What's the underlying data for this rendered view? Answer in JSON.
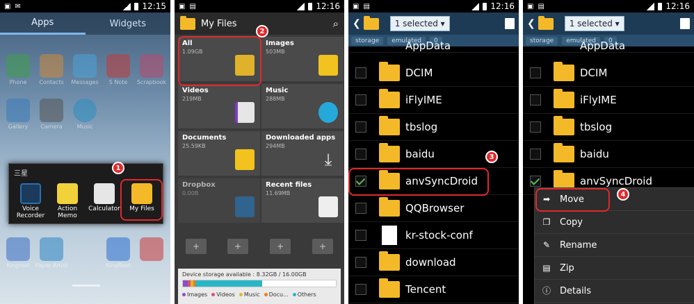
{
  "panel1": {
    "time": "12:15",
    "tabs": [
      "Apps",
      "Widgets"
    ],
    "bg_apps": [
      "Phone",
      "Contacts",
      "Messages",
      "S Note",
      "Scrapbook",
      "Gallery",
      "Camera",
      "Music",
      "Kingroot",
      "Paper Artist",
      "KingRoot"
    ],
    "folder_title": "三星",
    "folder_apps": [
      "Voice\nRecorder",
      "Action\nMemo",
      "Calculator",
      "My Files"
    ],
    "badge": "1"
  },
  "panel2": {
    "time": "12:16",
    "title": "My Files",
    "badge": "2",
    "categories": [
      {
        "name": "All",
        "size": "1.09GB"
      },
      {
        "name": "Images",
        "size": "503MB"
      },
      {
        "name": "Videos",
        "size": "219MB"
      },
      {
        "name": "Music",
        "size": "288MB"
      },
      {
        "name": "Documents",
        "size": "25.59KB"
      },
      {
        "name": "Downloaded apps",
        "size": "294MB"
      },
      {
        "name": "Dropbox",
        "size": "0.00B"
      },
      {
        "name": "Recent files",
        "size": "11.69MB"
      }
    ],
    "storage_label": "Device storage available : 8.32GB / 16.00GB",
    "legend": [
      "Images",
      "Videos",
      "Music",
      "Docu...",
      "Others"
    ],
    "legend_colors": [
      "#8a4fc2",
      "#e04a7f",
      "#e2b81f",
      "#f07d1a",
      "#29b7c6"
    ],
    "bar_fractions": [
      0.03,
      0.02,
      0.02,
      0.01,
      0.44
    ]
  },
  "panel3": {
    "time": "12:16",
    "selected": "1 selected",
    "crumbs": [
      "storage",
      "emulated",
      "0"
    ],
    "partial_top": "AppData",
    "folders": [
      "DCIM",
      "iFlyIME",
      "tbslog",
      "baidu",
      "anvSyncDroid",
      "QQBrowser",
      "kr-stock-conf",
      "download",
      "Tencent"
    ],
    "badge": "3"
  },
  "panel4": {
    "time": "12:16",
    "selected": "1 selected",
    "crumbs": [
      "storage",
      "emulated",
      "0"
    ],
    "partial_top": "AppData",
    "folders": [
      "DCIM",
      "iFlyIME",
      "tbslog",
      "baidu",
      "anvSyncDroid"
    ],
    "menu": [
      "Move",
      "Copy",
      "Rename",
      "Zip",
      "Details"
    ],
    "menu_icons": [
      "arrow-right-icon",
      "copy-icon",
      "rename-icon",
      "zip-icon",
      "info-icon"
    ],
    "badge": "4"
  }
}
